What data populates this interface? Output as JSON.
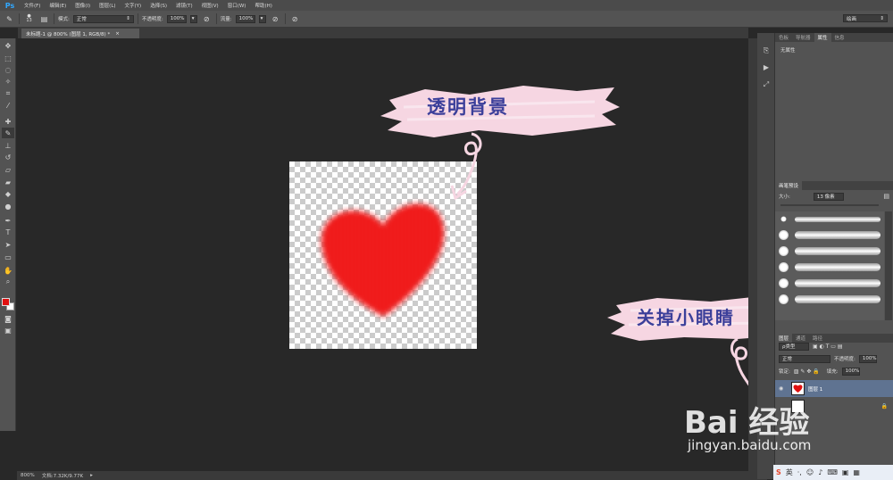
{
  "menubar": {
    "logo": "Ps",
    "items": [
      "文件(F)",
      "编辑(E)",
      "图像(I)",
      "图层(L)",
      "文字(Y)",
      "选择(S)",
      "滤镜(T)",
      "视图(V)",
      "窗口(W)",
      "帮助(H)"
    ]
  },
  "options": {
    "brush_size": "13",
    "mode_label": "模式:",
    "mode_value": "正常",
    "opacity_label": "不透明度:",
    "opacity_value": "100%",
    "flow_label": "流量:",
    "flow_value": "100%",
    "workspace": "绘画"
  },
  "document": {
    "tab_title": "未标题-1 @ 800% (图层 1, RGB/8) *",
    "zoom": "800%",
    "doc_info": "文档:7.32K/9.77K"
  },
  "panels": {
    "top_tabs": [
      "色板",
      "导航器",
      "属性",
      "信息"
    ],
    "active_top_tab": "属性",
    "properties_text": "无属性",
    "brush_presets_title": "画笔预设",
    "size_label": "大小:",
    "size_value": "13 像素",
    "layers_tabs": [
      "图层",
      "通道",
      "路径"
    ],
    "filter_kind": "ρ类型",
    "blend_mode": "正常",
    "layer_opacity_label": "不透明度:",
    "layer_opacity": "100%",
    "lock_label": "锁定:",
    "fill_label": "填充:",
    "fill_value": "100%",
    "layer1_name": "图层 1"
  },
  "annotations": {
    "top": "透明背景",
    "bottom": "关掉小眼睛"
  },
  "watermark": {
    "logo": "Bai 经验",
    "url": "jingyan.baidu.com"
  },
  "ime": {
    "label": "英"
  },
  "colors": {
    "foreground": "#e01010",
    "background": "#ffffff",
    "heart": "#f01818",
    "annotation_bg": "#f6d6e2",
    "annotation_text": "#3b3f9a"
  }
}
